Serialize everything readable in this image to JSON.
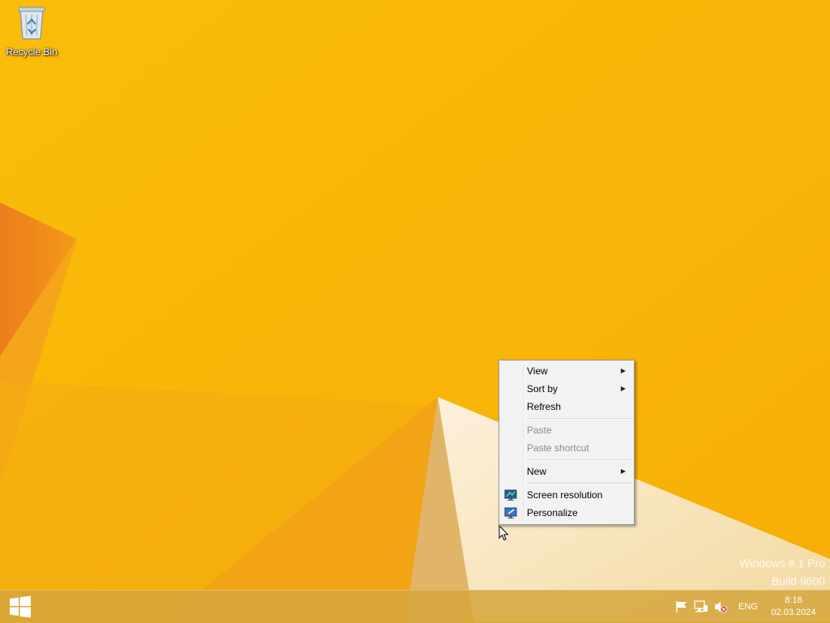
{
  "desktop": {
    "icons": [
      {
        "label": "Recycle Bin",
        "icon": "recycle-bin-icon"
      }
    ],
    "watermark": {
      "line1": "Windows 8.1 Pro",
      "line2": "Build 9600"
    }
  },
  "context_menu": {
    "items": [
      {
        "label": "View",
        "submenu": true,
        "enabled": true
      },
      {
        "label": "Sort by",
        "submenu": true,
        "enabled": true
      },
      {
        "label": "Refresh",
        "submenu": false,
        "enabled": true
      },
      {
        "label": "Paste",
        "submenu": false,
        "enabled": false
      },
      {
        "label": "Paste shortcut",
        "submenu": false,
        "enabled": false
      },
      {
        "label": "New",
        "submenu": true,
        "enabled": true
      },
      {
        "label": "Screen resolution",
        "submenu": false,
        "enabled": true,
        "icon": "display-icon"
      },
      {
        "label": "Personalize",
        "submenu": false,
        "enabled": true,
        "icon": "personalize-icon"
      }
    ],
    "submenu_arrow": "▶"
  },
  "taskbar": {
    "start_icon": "windows-logo-icon",
    "tray": {
      "icons": [
        "action-center-flag-icon",
        "network-icon",
        "speaker-muted-icon"
      ],
      "language": "ENG",
      "time": "8:18",
      "date": "02.03.2024"
    }
  },
  "colors": {
    "wallpaper_base": "#f9b800",
    "wallpaper_accent": "#f08a1c",
    "taskbar": "#d5a63c",
    "menu_bg": "#f2f2f2"
  }
}
